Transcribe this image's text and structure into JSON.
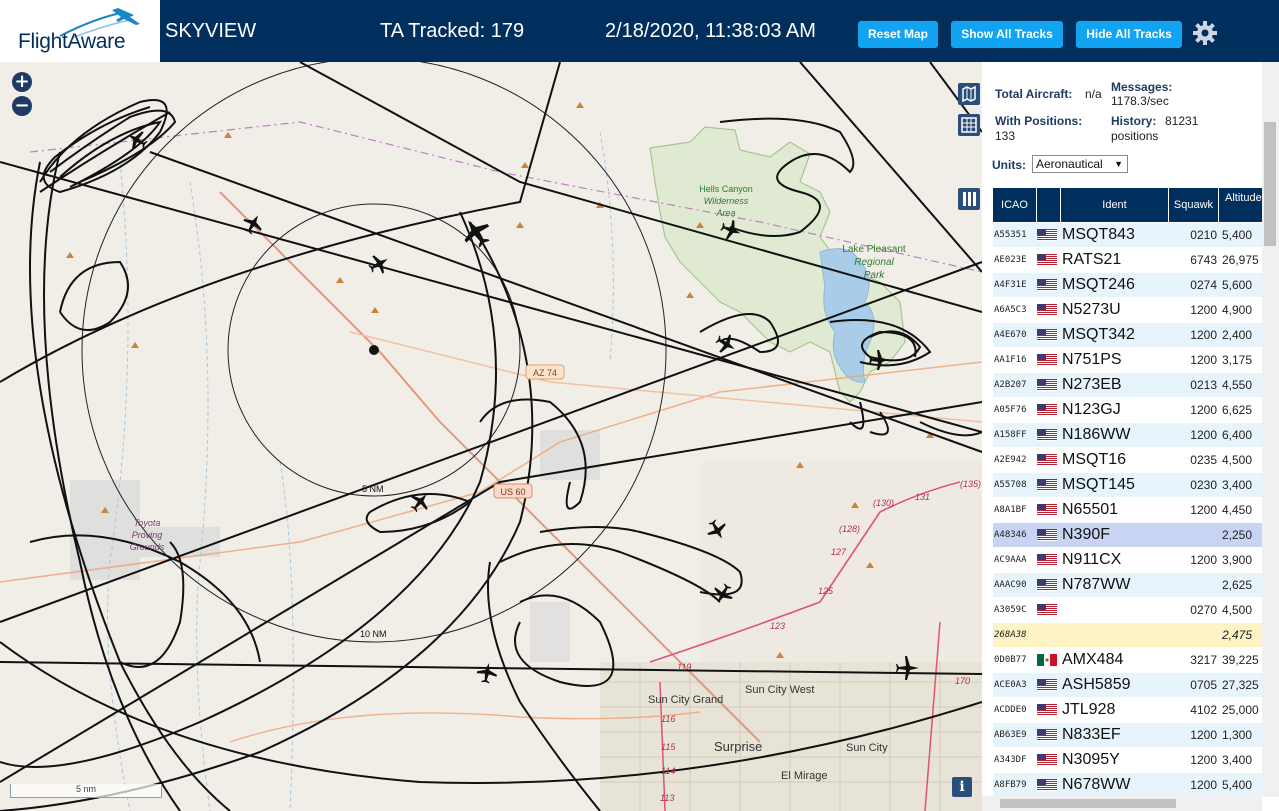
{
  "header": {
    "logo_text": "FlightAware",
    "title": "SKYVIEW",
    "tracked": "TA Tracked: 179",
    "datetime": "2/18/2020, 11:38:03 AM",
    "buttons": {
      "reset": "Reset Map",
      "show_all": "Show All Tracks",
      "hide_all": "Hide All Tracks"
    },
    "settings_icon": "gear-icon"
  },
  "map": {
    "labels": {
      "hells_canyon": [
        "Hells Canyon",
        "Wilderness",
        "Area"
      ],
      "lake_pleasant": [
        "Lake Pleasant",
        "Regional",
        "Park"
      ],
      "toyota": [
        "Toyota",
        "Proving",
        "Grounds"
      ],
      "az74": "AZ 74",
      "us60": "US 60",
      "ring_5nm": "5 NM",
      "ring_10nm": "10 NM",
      "sun_city_grand": "Sun City Grand",
      "sun_city_west": "Sun City West",
      "surprise": "Surprise",
      "sun_city": "Sun City",
      "el_mirage": "El Mirage",
      "r130": "(130)",
      "r128": "(128)",
      "r131": "131",
      "r127": "127",
      "r125": "125",
      "r123": "123",
      "r119": "119",
      "r116": "116",
      "r115": "115",
      "r114": "114",
      "r135": "(135)",
      "r170": "170",
      "r113": "113"
    },
    "zoom_in": "+",
    "zoom_out": "−",
    "scale_text": "5 nm",
    "info": "i",
    "tools": [
      "map-layers-icon",
      "grid-icon",
      "columns-icon"
    ]
  },
  "panel": {
    "total_aircraft_label": "Total Aircraft:",
    "total_aircraft_value": "n/a",
    "with_positions_label": "With Positions:",
    "with_positions_value": "133",
    "messages_label": "Messages:",
    "messages_value": "1178.3/sec",
    "history_label": "History:",
    "history_value": "81231",
    "history_unit": "positions",
    "units_label": "Units:",
    "units_value": "Aeronautical",
    "columns": [
      "ICAO",
      "Ident",
      "Squawk",
      "Altitude (ft)"
    ],
    "rows": [
      {
        "icao": "A55351",
        "flag": "us",
        "ident": "MSQT843",
        "squawk": "0210",
        "alt": "5,400"
      },
      {
        "icao": "AE023E",
        "flag": "us",
        "ident": "RATS21",
        "squawk": "6743",
        "alt": "26,975"
      },
      {
        "icao": "A4F31E",
        "flag": "us",
        "ident": "MSQT246",
        "squawk": "0274",
        "alt": "5,600"
      },
      {
        "icao": "A6A5C3",
        "flag": "us",
        "ident": "N5273U",
        "squawk": "1200",
        "alt": "4,900"
      },
      {
        "icao": "A4E670",
        "flag": "us",
        "ident": "MSQT342",
        "squawk": "1200",
        "alt": "2,400"
      },
      {
        "icao": "AA1F16",
        "flag": "us",
        "ident": "N751PS",
        "squawk": "1200",
        "alt": "3,175"
      },
      {
        "icao": "A2B207",
        "flag": "us",
        "ident": "N273EB",
        "squawk": "0213",
        "alt": "4,550"
      },
      {
        "icao": "A05F76",
        "flag": "us",
        "ident": "N123GJ",
        "squawk": "1200",
        "alt": "6,625"
      },
      {
        "icao": "A158FF",
        "flag": "us",
        "ident": "N186WW",
        "squawk": "1200",
        "alt": "6,400"
      },
      {
        "icao": "A2E942",
        "flag": "us",
        "ident": "MSQT16",
        "squawk": "0235",
        "alt": "4,500"
      },
      {
        "icao": "A55708",
        "flag": "us",
        "ident": "MSQT145",
        "squawk": "0230",
        "alt": "3,400"
      },
      {
        "icao": "A8A1BF",
        "flag": "us",
        "ident": "N65501",
        "squawk": "1200",
        "alt": "4,450"
      },
      {
        "icao": "A48346",
        "flag": "us",
        "ident": "N390F",
        "squawk": "",
        "alt": "2,250"
      },
      {
        "icao": "AC9AAA",
        "flag": "us",
        "ident": "N911CX",
        "squawk": "1200",
        "alt": "3,900"
      },
      {
        "icao": "AAAC90",
        "flag": "us",
        "ident": "N787WW",
        "squawk": "",
        "alt": "2,625"
      },
      {
        "icao": "A3059C",
        "flag": "us",
        "ident": "",
        "squawk": "0270",
        "alt": "4,500"
      },
      {
        "icao": "268A38",
        "flag": "",
        "ident": "",
        "squawk": "",
        "alt": "2,475"
      },
      {
        "icao": "0D0B77",
        "flag": "mx",
        "ident": "AMX484",
        "squawk": "3217",
        "alt": "39,225"
      },
      {
        "icao": "ACE0A3",
        "flag": "us",
        "ident": "ASH5859",
        "squawk": "0705",
        "alt": "27,325"
      },
      {
        "icao": "ACDDE0",
        "flag": "us",
        "ident": "JTL928",
        "squawk": "4102",
        "alt": "25,000"
      },
      {
        "icao": "AB63E9",
        "flag": "us",
        "ident": "N833EF",
        "squawk": "1200",
        "alt": "1,300"
      },
      {
        "icao": "A343DF",
        "flag": "us",
        "ident": "N3095Y",
        "squawk": "1200",
        "alt": "3,400"
      },
      {
        "icao": "A8FB79",
        "flag": "us",
        "ident": "N678WW",
        "squawk": "1200",
        "alt": "5,400"
      }
    ],
    "colors": {
      "header": "#002f5d",
      "row_alt": "#e8f4fb",
      "row_selected": "#c9d3f3",
      "row_mlat": "#fdf3c4",
      "button": "#12a4f0"
    }
  }
}
